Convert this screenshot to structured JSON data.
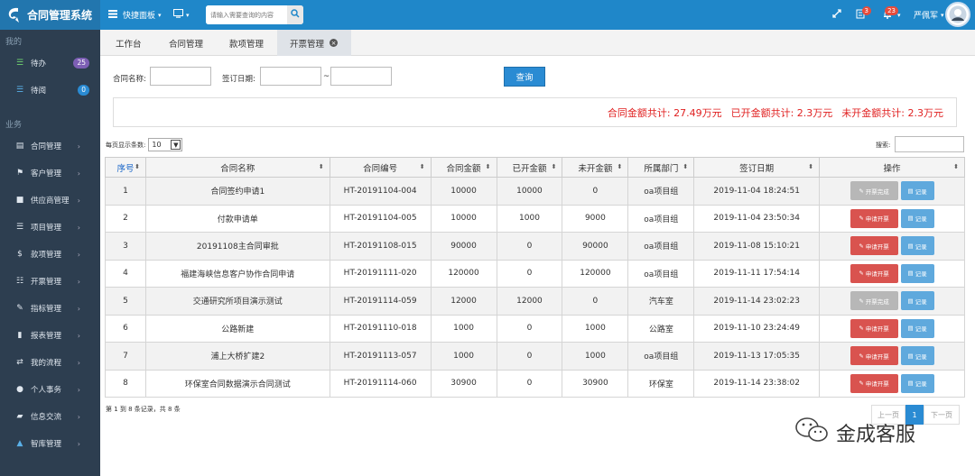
{
  "app": {
    "title": "合同管理系统"
  },
  "topbar": {
    "quick_panel": "快捷面板",
    "search_placeholder": "请输入需要查询的内容",
    "badge_1": "3",
    "badge_2": "23",
    "user_name": "严佩军"
  },
  "sidebar": {
    "section_mine": "我的",
    "todo": {
      "label": "待办",
      "count": "25"
    },
    "read": {
      "label": "待阅",
      "count": "0"
    },
    "section_business": "业务",
    "items": [
      {
        "label": "合同管理",
        "icon": "book-icon"
      },
      {
        "label": "客户管理",
        "icon": "tags-icon"
      },
      {
        "label": "供应商管理",
        "icon": "lock-icon"
      },
      {
        "label": "项目管理",
        "icon": "list-icon"
      },
      {
        "label": "款项管理",
        "icon": "dollar-icon"
      },
      {
        "label": "开票管理",
        "icon": "grid-icon"
      },
      {
        "label": "指标管理",
        "icon": "pencil-icon"
      },
      {
        "label": "报表管理",
        "icon": "bar-chart-icon"
      },
      {
        "label": "我的流程",
        "icon": "exchange-icon"
      },
      {
        "label": "个人事务",
        "icon": "user-icon"
      },
      {
        "label": "信息交流",
        "icon": "comment-icon"
      },
      {
        "label": "智库管理",
        "icon": "graduation-icon"
      }
    ]
  },
  "tabs": [
    {
      "label": "工作台"
    },
    {
      "label": "合同管理"
    },
    {
      "label": "款项管理"
    },
    {
      "label": "开票管理",
      "active": true
    }
  ],
  "filter": {
    "contract_name_label": "合同名称:",
    "sign_date_label": "签订日期:",
    "range_sep": "~",
    "query_btn": "查询"
  },
  "summary": {
    "total": "合同金额共计: 27.49万元",
    "invoiced": "已开金额共计: 2.3万元",
    "uninvoiced": "未开金额共计: 2.3万元"
  },
  "table_ctrl": {
    "per_page_label": "每页显示条数:",
    "per_page_value": "10",
    "search_label": "搜索:"
  },
  "table": {
    "headers": [
      "序号",
      "合同名称",
      "合同编号",
      "合同金额",
      "已开金额",
      "未开金额",
      "所属部门",
      "签订日期",
      "操作"
    ],
    "rows": [
      {
        "no": "1",
        "name": "合同签约申请1",
        "code": "HT-20191104-004",
        "amount": "10000",
        "invoiced": "10000",
        "uninvoiced": "0",
        "dept": "oa项目组",
        "date": "2019-11-04 18:24:51",
        "action": "开票完成",
        "status": "done"
      },
      {
        "no": "2",
        "name": "付款申请单",
        "code": "HT-20191104-005",
        "amount": "10000",
        "invoiced": "1000",
        "uninvoiced": "9000",
        "dept": "oa项目组",
        "date": "2019-11-04 23:50:34",
        "action": "申请开票",
        "status": "apply"
      },
      {
        "no": "3",
        "name": "20191108主合同审批",
        "code": "HT-20191108-015",
        "amount": "90000",
        "invoiced": "0",
        "uninvoiced": "90000",
        "dept": "oa项目组",
        "date": "2019-11-08 15:10:21",
        "action": "申请开票",
        "status": "apply"
      },
      {
        "no": "4",
        "name": "福建海峡信息客户协作合同申请",
        "code": "HT-20191111-020",
        "amount": "120000",
        "invoiced": "0",
        "uninvoiced": "120000",
        "dept": "oa项目组",
        "date": "2019-11-11 17:54:14",
        "action": "申请开票",
        "status": "apply"
      },
      {
        "no": "5",
        "name": "交通研究所项目演示测试",
        "code": "HT-20191114-059",
        "amount": "12000",
        "invoiced": "12000",
        "uninvoiced": "0",
        "dept": "汽车室",
        "date": "2019-11-14 23:02:23",
        "action": "开票完成",
        "status": "done"
      },
      {
        "no": "6",
        "name": "公路新建",
        "code": "HT-20191110-018",
        "amount": "1000",
        "invoiced": "0",
        "uninvoiced": "1000",
        "dept": "公路室",
        "date": "2019-11-10 23:24:49",
        "action": "申请开票",
        "status": "apply"
      },
      {
        "no": "7",
        "name": "浦上大桥扩建2",
        "code": "HT-20191113-057",
        "amount": "1000",
        "invoiced": "0",
        "uninvoiced": "1000",
        "dept": "oa项目组",
        "date": "2019-11-13 17:05:35",
        "action": "申请开票",
        "status": "apply"
      },
      {
        "no": "8",
        "name": "环保室合同数据演示合同测试",
        "code": "HT-20191114-060",
        "amount": "30900",
        "invoiced": "0",
        "uninvoiced": "30900",
        "dept": "环保室",
        "date": "2019-11-14 23:38:02",
        "action": "申请开票",
        "status": "apply"
      }
    ],
    "record_btn": "记录"
  },
  "footer": {
    "info": "第 1 到 8 条记录，共 8 条"
  },
  "pager": {
    "prev": "上一页",
    "current": "1",
    "next": "下一页"
  },
  "watermark": {
    "text": "金成客服"
  },
  "colors": {
    "topbar": "#1f87c9",
    "sidebar": "#2d3e50",
    "query_btn": "#2a8bd3",
    "summary_text": "#e02020",
    "apply_btn": "#d9534f",
    "done_btn": "#b7b7b7",
    "record_btn": "#5fa9dd"
  }
}
